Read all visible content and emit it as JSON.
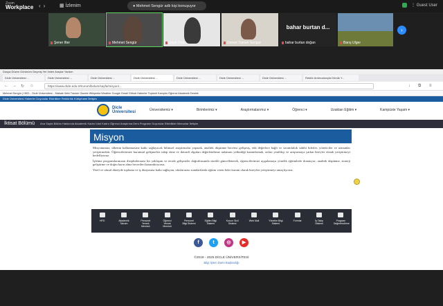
{
  "zoom": {
    "brand_small": "Zoom",
    "brand_large": "Workplace",
    "home_label": "İzlenim",
    "speaking": "Mehmet Sengür adlı kişi konuşuyor",
    "user": "Guest User",
    "next_icon": "chevron-right-icon"
  },
  "participants": [
    {
      "name": "Şener Ilter"
    },
    {
      "name": "Mehmet Sengür"
    },
    {
      "name": "Şeyh Ordu"
    },
    {
      "name": "Demet Yaman Sengur"
    },
    {
      "name": "bahar burtan doğan",
      "big": "bahar burtan d..."
    },
    {
      "name": "Barış Ulger"
    }
  ],
  "browser": {
    "menu": "Dosya   Düzen   Görünüm   Geçmiş   Yer İmleri   Araçlar   Yardım",
    "tabs": [
      "Dicle Üniversitesi ...",
      "Dicle Üniversitesi ...",
      "Dicle Üniversitesi ...",
      "Dicle Üniversitesi ...",
      "Dicle Üniversitesi ...",
      "Dicle Üniversitesi ...",
      "Dicle Üniversitesi ...",
      "Rektör Ambrozlarıyla Dönük Y..."
    ],
    "url": "https://www.dicle.edu.tr/Kurum/bolum/sayfa/misyon/...",
    "bookmarks": "Mehmet Sengür | HKD...   Dicle Üniversitesi...   Makale Web Tracker   Gazete   Wikipedia   Weather   Google   Gmail   Github   Haberler   Toplantı   Kampüs   Öğrenci   Akademik   Destek"
  },
  "site": {
    "topbar": "Dicle Üniversitesi   Haberler   Duyurular   Etkinlikler   Rektörlük   Kütüphane   İletişim",
    "logo_name": "Dicle Üniversitesi",
    "menu": [
      "Üniversitemiz ▾",
      "Birimlerimiz ▾",
      "Araştırmalarımız ▾",
      "Öğrenci ▾",
      "Uzaktan Eğitim ▾",
      "Kampüste Yaşam ▾"
    ],
    "dept_title": "İktisat Bölümü",
    "dept_items": "Ana Sayfa   Bölüm Hakkında   Akademik Kadro   İdari Kadro   Öğrenci   Araştırma   Ders Programı   Duyurular   Etkinlikler   Mezunlar   İletişim"
  },
  "content": {
    "heading": "Misyon",
    "paragraphs": [
      "Misyonumuz, ülkenin kalkınmasına katkı sağlayacak bilimsel araştırmalar yaparak, analitik düşünme becerisi gelişmiş, etik değerlere bağlı ve sorumluluk sahibi liderler, yöneticiler ve uzmanlar yetiştirmektir. Öğrencilerimize kuramsal gelişmeleri takip etme ve iktisadi olguları değerlendirme anlamını yetkinliği kazandırmak, onları yenilikçi ve araştırmaya yatkın bireyler olarak yetiştirmeyi hedefliyoruz.",
      "İşletme programlarımızın disiplinlerarası bir yaklaşım ve teorik gelişmeler doğrultusunda sürekli güncellenerek, öğrencilerimizi uygulamaya yönelik eğitimlerle donatıyor; analitik düşünme, strateji geliştirme ve doğru karar alma becerileri kazandırıyoruz.",
      "Yerel ve ulusal düzeyde topluma ve iş dünyasına katkı sağlayan, uluslararası standartlarda eğitim veren lider kurum olarak bireyleri yetiştirmeyi amaçlıyoruz."
    ]
  },
  "quick_links": [
    {
      "label": "HPD",
      "icon": "document-icon"
    },
    {
      "label": "Akademik Takvim",
      "icon": "calendar-icon"
    },
    {
      "label": "Personel Yemek Menüsü",
      "icon": "fork-knife-icon"
    },
    {
      "label": "Öğrenci Yemek Menüsü",
      "icon": "fork-knife-icon"
    },
    {
      "label": "Personel Bilgi Sistemi",
      "icon": "database-icon"
    },
    {
      "label": "Eğitim Bilgi Sistemi",
      "icon": "graduation-icon"
    },
    {
      "label": "Kurum Sicil Sistemi",
      "icon": "building-icon"
    },
    {
      "label": "Web Mail",
      "icon": "mail-icon"
    },
    {
      "label": "Yönetim Bilgi Sistemi",
      "icon": "chart-icon"
    },
    {
      "label": "Formlar",
      "icon": "form-icon"
    },
    {
      "label": "İş Takip Sistemi",
      "icon": "task-icon"
    },
    {
      "label": "Program Değerlendirme",
      "icon": "checklist-icon"
    }
  ],
  "footer": {
    "social": [
      {
        "name": "facebook-icon",
        "glyph": "f",
        "color": "#3b5998"
      },
      {
        "name": "twitter-icon",
        "glyph": "t",
        "color": "#1da1f2"
      },
      {
        "name": "instagram-icon",
        "glyph": "◎",
        "color": "#c13584"
      },
      {
        "name": "youtube-icon",
        "glyph": "▶",
        "color": "#e52d27"
      }
    ],
    "copyright": "©2019 - 2025 DİCLE ÜNİVERSİTESİ",
    "credit": "Bilgi İşlem Daire Başkanlığı"
  }
}
